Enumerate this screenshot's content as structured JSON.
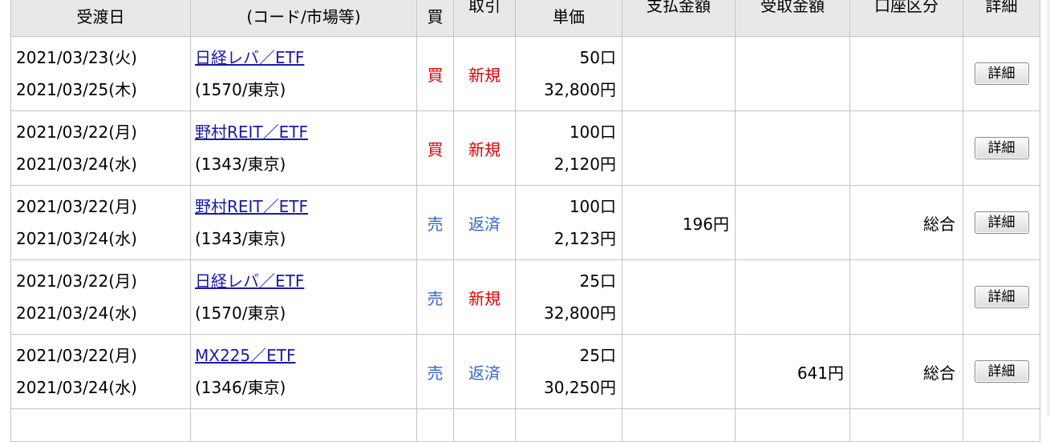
{
  "headers": {
    "date": "受渡日",
    "name": "(コード/市場等)",
    "side": "買",
    "kind": "取引",
    "price": "単価",
    "pay": "支払金額",
    "receive": "受取金額",
    "account": "口座区分",
    "detail": "詳細"
  },
  "rows": [
    {
      "order_date": "2021/03/23(火)",
      "settle_date": "2021/03/25(木)",
      "name": "日経レバ／ETF",
      "code": "(1570/東京)",
      "side": "買",
      "kind": "新規",
      "qty": "50口",
      "price": "32,800円",
      "pay": "",
      "receive": "",
      "account": "",
      "detail": "詳細"
    },
    {
      "order_date": "2021/03/22(月)",
      "settle_date": "2021/03/24(水)",
      "name": "野村REIT／ETF",
      "code": "(1343/東京)",
      "side": "買",
      "kind": "新規",
      "qty": "100口",
      "price": "2,120円",
      "pay": "",
      "receive": "",
      "account": "",
      "detail": "詳細"
    },
    {
      "order_date": "2021/03/22(月)",
      "settle_date": "2021/03/24(水)",
      "name": "野村REIT／ETF",
      "code": "(1343/東京)",
      "side": "売",
      "kind": "返済",
      "qty": "100口",
      "price": "2,123円",
      "pay": "196円",
      "receive": "",
      "account": "総合",
      "detail": "詳細"
    },
    {
      "order_date": "2021/03/22(月)",
      "settle_date": "2021/03/24(水)",
      "name": "日経レバ／ETF",
      "code": "(1570/東京)",
      "side": "売",
      "kind": "新規",
      "qty": "25口",
      "price": "32,800円",
      "pay": "",
      "receive": "",
      "account": "",
      "detail": "詳細"
    },
    {
      "order_date": "2021/03/22(月)",
      "settle_date": "2021/03/24(水)",
      "name": "MX225／ETF",
      "code": "(1346/東京)",
      "side": "売",
      "kind": "返済",
      "qty": "25口",
      "price": "30,250円",
      "pay": "",
      "receive": "641円",
      "account": "総合",
      "detail": "詳細"
    }
  ],
  "colors": {
    "buy": "#e00000",
    "sell": "#3366cc",
    "link": "#1a1aa6"
  }
}
